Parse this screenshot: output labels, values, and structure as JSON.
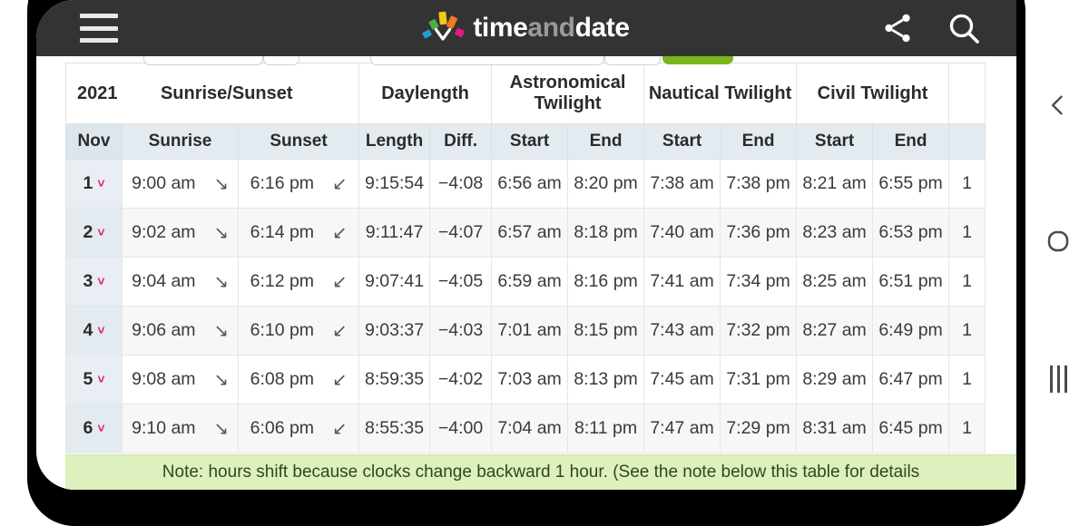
{
  "appbar": {
    "menu_icon": "hamburger-menu-icon",
    "logo": {
      "part1": "time",
      "part2": "and",
      "part3": "date"
    },
    "share_icon": "share-icon",
    "search_icon": "search-icon"
  },
  "table": {
    "group_headers": {
      "year": "2021",
      "sunrise_sunset": "Sunrise/Sunset",
      "daylength": "Daylength",
      "astronomical_twilight": "Astronomical Twilight",
      "nautical_twilight": "Nautical Twilight",
      "civil_twilight": "Civil Twilight"
    },
    "sub_headers": {
      "month": "Nov",
      "sunrise": "Sunrise",
      "sunset": "Sunset",
      "length": "Length",
      "diff": "Diff.",
      "astro_start": "Start",
      "astro_end": "End",
      "naut_start": "Start",
      "naut_end": "End",
      "civil_start": "Start",
      "civil_end": "End"
    },
    "rows": [
      {
        "day": "1",
        "chevron": "˅",
        "sunrise": "9:00 am",
        "sunrise_arrow": "↘",
        "sunset": "6:16 pm",
        "sunset_arrow": "↙",
        "length": "9:15:54",
        "diff": "−4:08",
        "astro_start": "6:56 am",
        "astro_end": "8:20 pm",
        "naut_start": "7:38 am",
        "naut_end": "7:38 pm",
        "civil_start": "8:21 am",
        "civil_end": "6:55 pm",
        "partial": "1"
      },
      {
        "day": "2",
        "chevron": "˅",
        "sunrise": "9:02 am",
        "sunrise_arrow": "↘",
        "sunset": "6:14 pm",
        "sunset_arrow": "↙",
        "length": "9:11:47",
        "diff": "−4:07",
        "astro_start": "6:57 am",
        "astro_end": "8:18 pm",
        "naut_start": "7:40 am",
        "naut_end": "7:36 pm",
        "civil_start": "8:23 am",
        "civil_end": "6:53 pm",
        "partial": "1"
      },
      {
        "day": "3",
        "chevron": "˅",
        "sunrise": "9:04 am",
        "sunrise_arrow": "↘",
        "sunset": "6:12 pm",
        "sunset_arrow": "↙",
        "length": "9:07:41",
        "diff": "−4:05",
        "astro_start": "6:59 am",
        "astro_end": "8:16 pm",
        "naut_start": "7:41 am",
        "naut_end": "7:34 pm",
        "civil_start": "8:25 am",
        "civil_end": "6:51 pm",
        "partial": "1"
      },
      {
        "day": "4",
        "chevron": "˅",
        "sunrise": "9:06 am",
        "sunrise_arrow": "↘",
        "sunset": "6:10 pm",
        "sunset_arrow": "↙",
        "length": "9:03:37",
        "diff": "−4:03",
        "astro_start": "7:01 am",
        "astro_end": "8:15 pm",
        "naut_start": "7:43 am",
        "naut_end": "7:32 pm",
        "civil_start": "8:27 am",
        "civil_end": "6:49 pm",
        "partial": "1"
      },
      {
        "day": "5",
        "chevron": "˅",
        "sunrise": "9:08 am",
        "sunrise_arrow": "↘",
        "sunset": "6:08 pm",
        "sunset_arrow": "↙",
        "length": "8:59:35",
        "diff": "−4:02",
        "astro_start": "7:03 am",
        "astro_end": "8:13 pm",
        "naut_start": "7:45 am",
        "naut_end": "7:31 pm",
        "civil_start": "8:29 am",
        "civil_end": "6:47 pm",
        "partial": "1"
      },
      {
        "day": "6",
        "chevron": "˅",
        "sunrise": "9:10 am",
        "sunrise_arrow": "↘",
        "sunset": "6:06 pm",
        "sunset_arrow": "↙",
        "length": "8:55:35",
        "diff": "−4:00",
        "astro_start": "7:04 am",
        "astro_end": "8:11 pm",
        "naut_start": "7:47 am",
        "naut_end": "7:29 pm",
        "civil_start": "8:31 am",
        "civil_end": "6:45 pm",
        "partial": "1"
      }
    ]
  },
  "note": {
    "text": "Note: hours shift because clocks change backward 1 hour. (See the note below this table for details"
  },
  "navigation": {
    "back_icon": "chevron-left-icon",
    "home_icon": "circle-icon",
    "recents_icon": "vertical-bars-icon"
  },
  "colors": {
    "appbar_bg": "#333333",
    "accent_pink": "#e01b63",
    "button_green": "#7ab51d",
    "note_bg": "#ddf0bd",
    "day_col_bg": "#e8eef3",
    "subheader_bg": "#e4ebf0"
  }
}
